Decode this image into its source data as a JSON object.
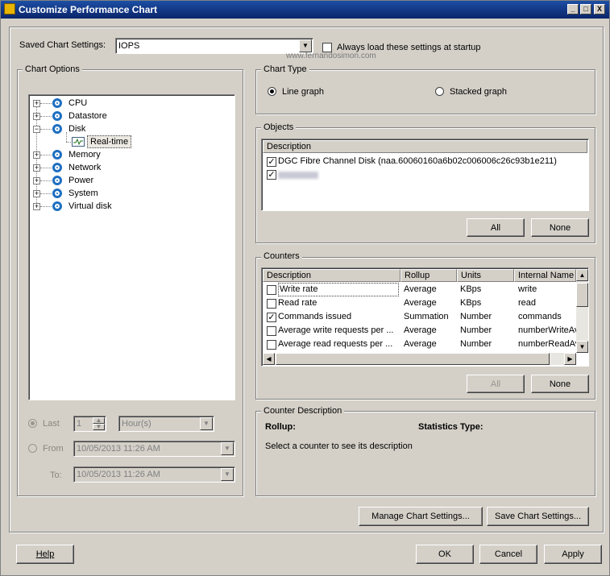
{
  "window": {
    "title": "Customize Performance Chart",
    "minimize": "_",
    "maximize": "□",
    "close": "X"
  },
  "saved": {
    "label": "Saved Chart Settings:",
    "value": "IOPS",
    "always_load_label": "Always load these settings at startup",
    "always_load_checked": false
  },
  "watermark": "www.fernandosimon.com",
  "chart_options": {
    "title": "Chart Options",
    "tree": [
      {
        "label": "CPU",
        "expander": "+"
      },
      {
        "label": "Datastore",
        "expander": "+"
      },
      {
        "label": "Disk",
        "expander": "−"
      },
      {
        "label": "Real-time",
        "child": true
      },
      {
        "label": "Memory",
        "expander": "+"
      },
      {
        "label": "Network",
        "expander": "+"
      },
      {
        "label": "Power",
        "expander": "+"
      },
      {
        "label": "System",
        "expander": "+"
      },
      {
        "label": "Virtual disk",
        "expander": "+"
      }
    ],
    "last_label": "Last",
    "last_value": "1",
    "last_unit": "Hour(s)",
    "from_label": "From",
    "from_value": "10/05/2013 11:26 AM",
    "to_label": "To:",
    "to_value": "10/05/2013 11:26 AM"
  },
  "chart_type": {
    "title": "Chart Type",
    "line_label": "Line graph",
    "stacked_label": "Stacked graph",
    "selected": "line"
  },
  "objects": {
    "title": "Objects",
    "header": "Description",
    "rows": [
      {
        "checked": true,
        "text": "DGC Fibre Channel Disk (naa.60060160a6b02c006006c26c93b1e211)"
      },
      {
        "checked": true,
        "text": ""
      }
    ],
    "all_label": "All",
    "none_label": "None"
  },
  "counters": {
    "title": "Counters",
    "headers": [
      "Description",
      "Rollup",
      "Units",
      "Internal Name"
    ],
    "rows": [
      {
        "checked": false,
        "description": "Write rate",
        "rollup": "Average",
        "units": "KBps",
        "internal": "write"
      },
      {
        "checked": false,
        "description": "Read rate",
        "rollup": "Average",
        "units": "KBps",
        "internal": "read"
      },
      {
        "checked": true,
        "description": "Commands issued",
        "rollup": "Summation",
        "units": "Number",
        "internal": "commands"
      },
      {
        "checked": false,
        "description": "Average write requests per ...",
        "rollup": "Average",
        "units": "Number",
        "internal": "numberWriteAv"
      },
      {
        "checked": false,
        "description": "Average read requests per ...",
        "rollup": "Average",
        "units": "Number",
        "internal": "numberReadAv"
      }
    ],
    "all_label": "All",
    "none_label": "None"
  },
  "counter_description": {
    "title": "Counter Description",
    "rollup_label": "Rollup:",
    "stats_label": "Statistics Type:",
    "hint": "Select a counter to see its description"
  },
  "buttons": {
    "manage": "Manage Chart Settings...",
    "save": "Save Chart Settings...",
    "help": "Help",
    "ok": "OK",
    "cancel": "Cancel",
    "apply": "Apply"
  }
}
